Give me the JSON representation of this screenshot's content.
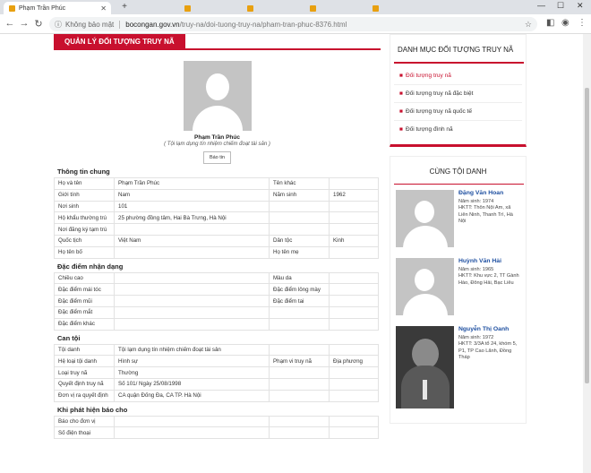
{
  "browser": {
    "tabs": [
      {
        "title": "Phạm Trần Phúc"
      },
      {
        "title": ""
      },
      {
        "title": ""
      },
      {
        "title": ""
      },
      {
        "title": ""
      }
    ],
    "security_label": "Không bảo mật",
    "url_host": "bocongan.gov.vn",
    "url_path": "/truy-na/doi-tuong-truy-na/pham-tran-phuc-8376.html"
  },
  "section_label": "QUẢN LÝ ĐỐI TƯỢNG TRUY NÃ",
  "profile": {
    "name": "Phạm Trần Phúc",
    "crime": "( Tội lạm dụng tín nhiệm chiếm đoạt tài sản )",
    "report_button": "Báo tin"
  },
  "groups": {
    "general": "Thông tin chung",
    "features": "Đặc điểm nhận dạng",
    "crime": "Can tội",
    "report": "Khi phát hiện báo cho"
  },
  "general_rows": [
    [
      "Họ và tên",
      "Phạm Trần Phúc",
      "Tên khác",
      ""
    ],
    [
      "Giới tính",
      "Nam",
      "Năm sinh",
      "1962"
    ],
    [
      "Nơi sinh",
      "101",
      "",
      ""
    ],
    [
      "Hộ khẩu thường trú",
      "25 phường đồng tâm, Hai Bà Trưng, Hà Nội",
      "",
      ""
    ],
    [
      "Nơi đăng ký tạm trú",
      "",
      "",
      ""
    ],
    [
      "Quốc tịch",
      "Việt Nam",
      "Dân tộc",
      "Kinh"
    ],
    [
      "Họ tên bố",
      "",
      "Họ tên mẹ",
      ""
    ]
  ],
  "feature_rows": [
    [
      "Chiều cao",
      "",
      "Màu da",
      ""
    ],
    [
      "Đặc điểm mái tóc",
      "",
      "Đặc điểm lông mày",
      ""
    ],
    [
      "Đặc điểm mũi",
      "",
      "Đặc điểm tai",
      ""
    ],
    [
      "Đặc điểm mắt",
      "",
      "",
      ""
    ],
    [
      "Đặc điểm khác",
      "",
      "",
      ""
    ]
  ],
  "crime_rows": [
    [
      "Tội danh",
      "Tội lạm dụng tín nhiệm chiếm đoạt tài sản",
      "",
      ""
    ],
    [
      "Hệ loại tội danh",
      "Hình sự",
      "Phạm vi truy nã",
      "Địa phương"
    ],
    [
      "Loại truy nã",
      "Thường",
      "",
      ""
    ],
    [
      "Quyết định truy nã",
      "Số 101/ Ngày 25/08/1998",
      "",
      ""
    ],
    [
      "Đơn vị ra quyết định",
      "CA quận Đống Đa, CA TP. Hà Nội",
      "",
      ""
    ]
  ],
  "report_rows": [
    [
      "Báo cho đơn vị",
      "",
      "",
      ""
    ],
    [
      "Số điện thoại",
      "",
      "",
      ""
    ]
  ],
  "sidebar": {
    "category_title": "DANH MỤC ĐỐI TƯỢNG TRUY NÃ",
    "categories": [
      "Đối tượng truy nã",
      "Đối tượng truy nã đặc biệt",
      "Đối tượng truy nã quốc tế",
      "Đối tượng đình nã"
    ],
    "related_title": "CÙNG TỘI DANH",
    "related": [
      {
        "name": "Đặng Văn Hoan",
        "birth": "Năm sinh: 1974",
        "address": "HKTT: Thôn Nội Am, xã Liên Ninh, Thanh Trì, Hà Nội"
      },
      {
        "name": "Huỳnh Văn Hải",
        "birth": "Năm sinh: 1965",
        "address": "HKTT: Khu vực 2, TT Gành Hào, Đông Hải, Bạc Liêu"
      },
      {
        "name": "Nguyễn Thị Oanh",
        "birth": "Năm sinh: 1972",
        "address": "HKTT: 3/3A tổ 24, khóm 5, P1, TP Cao Lãnh, Đồng Tháp"
      }
    ]
  }
}
